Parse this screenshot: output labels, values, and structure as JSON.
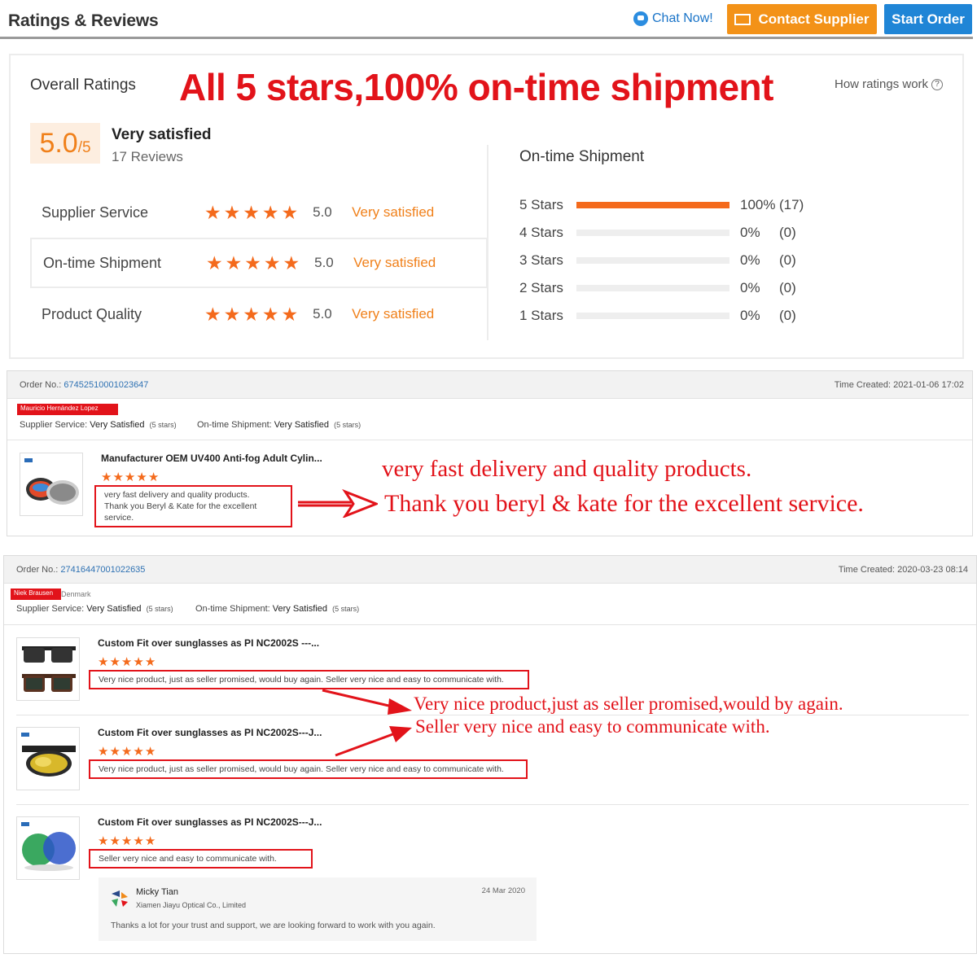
{
  "header": {
    "title": "Ratings & Reviews",
    "chat_label": "Chat Now!",
    "contact_label": "Contact Supplier",
    "start_label": "Start Order"
  },
  "overall": {
    "label": "Overall Ratings",
    "headline": "All 5 stars,100% on-time shipment",
    "how_label": "How ratings work",
    "score": "5.0",
    "score_suffix": "/5",
    "verdict": "Very satisfied",
    "reviews": "17 Reviews",
    "categories": [
      {
        "label": "Supplier Service",
        "stars": 5,
        "value": "5.0",
        "verdict": "Very satisfied"
      },
      {
        "label": "On-time Shipment",
        "stars": 5,
        "value": "5.0",
        "verdict": "Very satisfied"
      },
      {
        "label": "Product Quality",
        "stars": 5,
        "value": "5.0",
        "verdict": "Very satisfied"
      }
    ]
  },
  "shipment": {
    "title": "On-time Shipment",
    "rows": [
      {
        "label": "5 Stars",
        "fraction": 1.0,
        "pct": "100%",
        "count": "(17)"
      },
      {
        "label": "4 Stars",
        "fraction": 0,
        "pct": "0%",
        "count": "(0)"
      },
      {
        "label": "3 Stars",
        "fraction": 0,
        "pct": "0%",
        "count": "(0)"
      },
      {
        "label": "2 Stars",
        "fraction": 0,
        "pct": "0%",
        "count": "(0)"
      },
      {
        "label": "1 Stars",
        "fraction": 0,
        "pct": "0%",
        "count": "(0)"
      }
    ]
  },
  "orders": [
    {
      "order_label": "Order No.:",
      "order_no": "67452510001023647",
      "time_label": "Time Created:",
      "time": "2021-01-06 17:02",
      "buyer": "Mauricio Hernández Lopez",
      "supplier_service_label": "Supplier Service:",
      "supplier_service": "Very Satisfied",
      "supplier_stars": "(5 stars)",
      "shipment_label": "On-time Shipment:",
      "shipment": "Very Satisfied",
      "shipment_stars": "(5 stars)",
      "items": [
        {
          "name": "Manufacturer OEM UV400 Anti-fog Adult Cylin...",
          "stars": 5,
          "review_line1": "very fast delivery and quality products.",
          "review_line2": "Thank you Beryl & Kate for the excellent service."
        }
      ],
      "callout_line1": "very fast delivery and quality products.",
      "callout_line2": "Thank you beryl & kate for the excellent service."
    },
    {
      "order_label": "Order No.:",
      "order_no": "27416447001022635",
      "time_label": "Time Created:",
      "time": "2020-03-23 08:14",
      "buyer": "Niek Brausen",
      "country": "Denmark",
      "supplier_service_label": "Supplier Service:",
      "supplier_service": "Very Satisfied",
      "supplier_stars": "(5 stars)",
      "shipment_label": "On-time Shipment:",
      "shipment": "Very Satisfied",
      "shipment_stars": "(5 stars)",
      "items": [
        {
          "name": "Custom Fit over sunglasses as PI NC2002S ---...",
          "stars": 5,
          "review": "Very nice product, just as seller promised, would buy again. Seller very nice and easy to communicate with."
        },
        {
          "name": "Custom Fit over sunglasses as PI NC2002S---J...",
          "stars": 5,
          "review": "Very nice product, just as seller promised, would buy again. Seller very nice and easy to communicate with."
        },
        {
          "name": "Custom Fit over sunglasses as PI NC2002S---J...",
          "stars": 5,
          "review": "Seller very nice and easy to communicate with."
        }
      ],
      "callout_line1": "Very nice product,just as seller promised,would by again.",
      "callout_line2": "Seller very nice and easy to communicate with.",
      "reply": {
        "name": "Micky Tian",
        "company": "Xiamen Jiayu Optical Co., Limited",
        "date": "24 Mar 2020",
        "text": "Thanks a lot for your trust and support, we are looking forward to work with you again."
      }
    }
  ],
  "colors": {
    "accent": "#f46a1c",
    "red": "#e2131a",
    "contact": "#f39218",
    "start": "#1f85d6",
    "link": "#2e71b3"
  }
}
